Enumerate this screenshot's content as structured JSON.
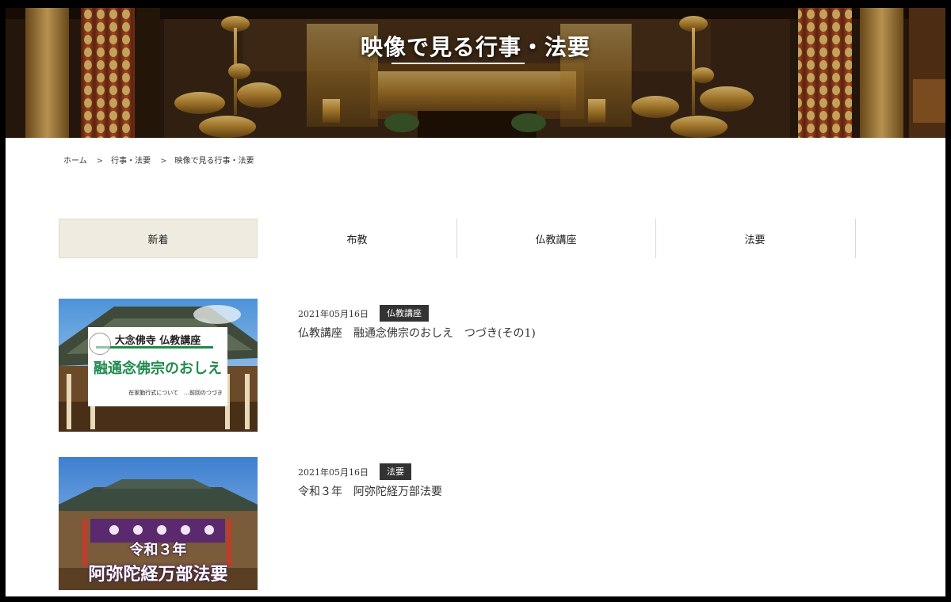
{
  "hero": {
    "title": "映像で見る行事・法要"
  },
  "breadcrumb": {
    "items": [
      "ホーム",
      "行事・法要",
      "映像で見る行事・法要"
    ],
    "separator": ">"
  },
  "tabs": [
    {
      "label": "新着",
      "active": true
    },
    {
      "label": "布教",
      "active": false
    },
    {
      "label": "仏教講座",
      "active": false
    },
    {
      "label": "法要",
      "active": false
    }
  ],
  "posts": [
    {
      "date": "2021年05月16日",
      "category": "仏教講座",
      "title": "仏教講座　融通念佛宗のおしえ　つづき(その1)",
      "thumbnail": {
        "heading": "大念佛寺 仏教講座",
        "main_text": "融通念佛宗のおしえ",
        "sub_text": "在家勤行式について　…前回のつづき"
      }
    },
    {
      "date": "2021年05月16日",
      "category": "法要",
      "title": "令和３年　阿弥陀経万部法要",
      "thumbnail": {
        "line1": "令和３年",
        "line2": "阿弥陀経万部法要"
      }
    }
  ],
  "colors": {
    "active_tab_bg": "#efebe0",
    "tag_bg": "#333333",
    "accent_green": "#1f8a4c"
  }
}
